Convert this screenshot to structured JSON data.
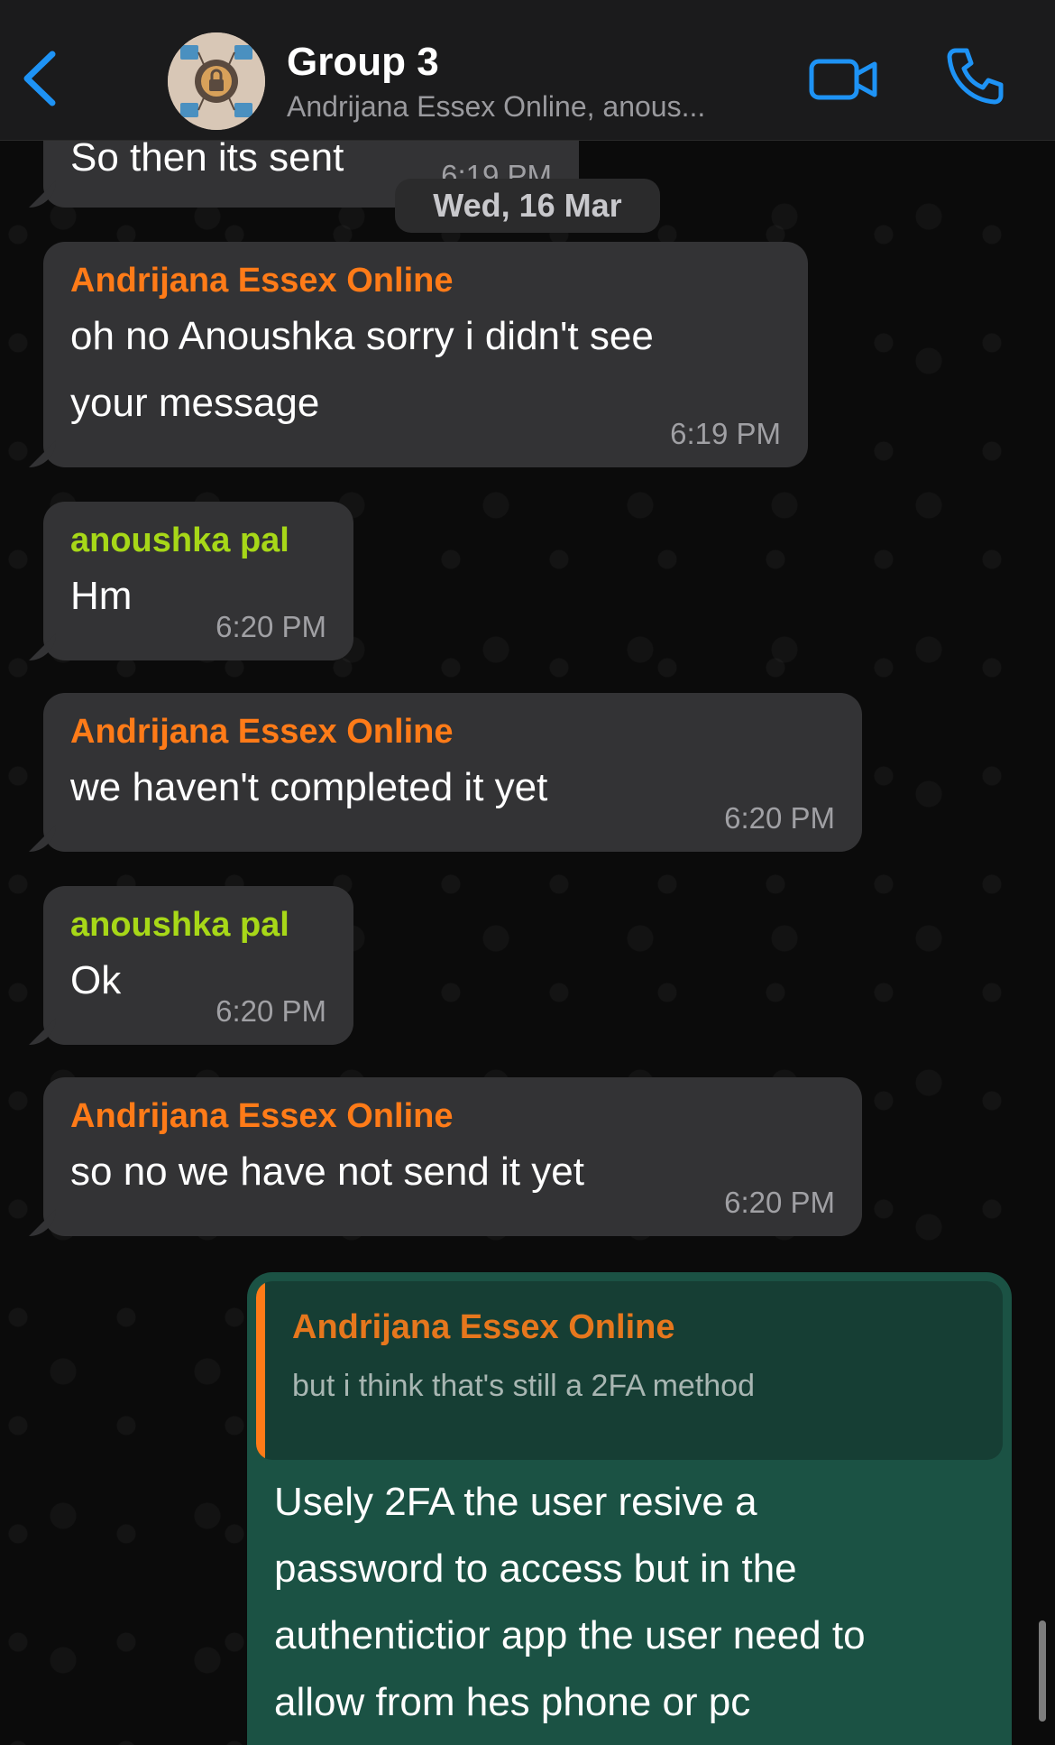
{
  "header": {
    "title": "Group 3",
    "subtitle": "Andrijana Essex Online, anous..."
  },
  "colors": {
    "accent_blue": "#1e93f5",
    "sender_orange": "#ff7b18",
    "sender_green": "#a7d818",
    "own_bubble": "#1b5244",
    "incoming_bubble": "#333335"
  },
  "messages": {
    "partial": {
      "text": "So then its sent",
      "time": "6:19 PM"
    },
    "date_separator": "Wed, 16 Mar",
    "m1": {
      "sender": "Andrijana Essex Online",
      "lines": [
        "oh no Anoushka sorry i didn't see",
        "your message"
      ],
      "time": "6:19 PM"
    },
    "m2": {
      "sender": "anoushka pal",
      "text": "Hm",
      "time": "6:20 PM"
    },
    "m3": {
      "sender": "Andrijana Essex Online",
      "text": "we haven't completed it yet",
      "time": "6:20 PM"
    },
    "m4": {
      "sender": "anoushka pal",
      "text": "Ok",
      "time": "6:20 PM"
    },
    "m5": {
      "sender": "Andrijana Essex Online",
      "text": "so no we have not send it yet",
      "time": "6:20 PM"
    },
    "own": {
      "quote_sender": "Andrijana Essex Online",
      "quote_text": "but i think that's still a 2FA method",
      "lines": [
        "Usely 2FA the user resive a",
        "password to access but in the",
        "authentictior app the user need to",
        "allow from hes phone or pc"
      ]
    }
  }
}
